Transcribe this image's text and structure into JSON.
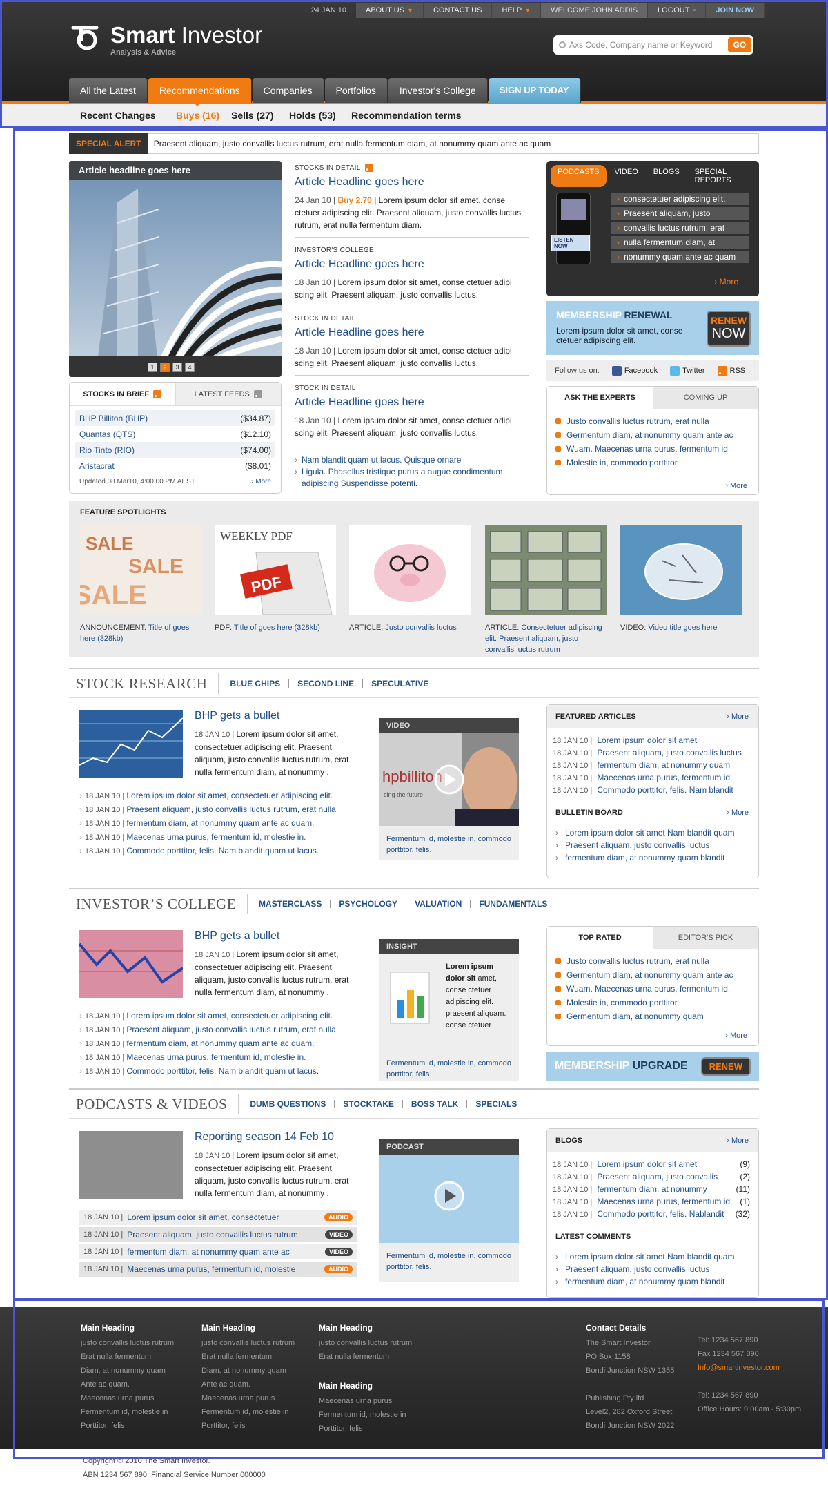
{
  "topbar": {
    "date": "24 JAN 10",
    "items": [
      "ABOUT US",
      "CONTACT US",
      "HELP",
      "WELCOME JOHN ADDIS",
      "LOGOUT",
      "JOIN NOW"
    ]
  },
  "brand": {
    "name_bold": "Smart",
    "name_light": " Investor",
    "tagline": "Analysis & Advice"
  },
  "search": {
    "placeholder": "Axs Code, Company name or Keyword",
    "go": "GO"
  },
  "nav": [
    "All the Latest",
    "Recommendations",
    "Companies",
    "Portfolios",
    "Investor's College",
    "SIGN UP TODAY"
  ],
  "subnav": [
    "Recent Changes",
    "Buys (16)",
    "Sells (27)",
    "Holds (53)",
    "Recommendation terms"
  ],
  "alert": {
    "label": "SPECIAL ALERT",
    "text": "Praesent aliquam,  justo convallis luctus rutrum, erat nulla fermentum diam, at nonummy quam  ante ac quam"
  },
  "hero": {
    "caption": "Article headline goes here",
    "dots": [
      "1",
      "2",
      "3",
      "4"
    ]
  },
  "brief": {
    "tab1": "STOCKS IN BRIEF",
    "tab2": "LATEST FEEDS",
    "rows": [
      [
        "BHP Billiton (BHP)",
        "($34.87)"
      ],
      [
        "Quantas (QTS)",
        "($12.10)"
      ],
      [
        "Rio Tinto (RIO)",
        "($74.00)"
      ],
      [
        "Aristacrat",
        "($8.01)"
      ]
    ],
    "updated": "Updated 08 Mar10, 4:00:00 PM AEST",
    "more": "› More"
  },
  "articles": [
    {
      "kicker": "STOCKS IN DETAIL",
      "headline": "Article Headline goes here",
      "date": "24 Jan 10 | ",
      "buy": "Buy 2.70",
      "sep": " | ",
      "body": "Lorem ipsum dolor sit amet, conse ctetuer adipiscing elit. Praesent aliquam,  justo convallis luctus rutrum, erat nulla fermentum diam."
    },
    {
      "kicker": "INVESTOR'S COLLEGE",
      "headline": "Article Headline goes here",
      "date": "18 Jan 10 | ",
      "body": "Lorem ipsum dolor sit amet, conse ctetuer adipi scing elit. Praesent aliquam,  justo convallis luctus."
    },
    {
      "kicker": "STOCK IN DETAIL",
      "headline": "Article Headline goes here",
      "date": "18 Jan 10 | ",
      "body": "Lorem ipsum dolor sit amet, conse ctetuer adipi scing elit. Praesent aliquam,  justo convallis luctus."
    },
    {
      "kicker": "STOCK IN DETAIL",
      "headline": "Article Headline goes here",
      "date": "18 Jan 10 | ",
      "body": "Lorem ipsum dolor sit amet, conse ctetuer adipi scing elit. Praesent aliquam,  justo convallis luctus."
    }
  ],
  "article_links": [
    "Nam blandit quam ut lacus. Quisque ornare",
    "Ligula. Phasellus tristique purus a augue condimentum adipiscing Suspendisse potenti."
  ],
  "podcasts": {
    "tabs": [
      "PODCASTS",
      "VIDEO",
      "BLOGS",
      "SPECIAL REPORTS"
    ],
    "listen": "LISTEN NOW",
    "items": [
      "consectetuer adipiscing elit.",
      "Praesent aliquam,  justo",
      "convallis luctus rutrum, erat",
      "nulla fermentum diam, at",
      "nonummy quam  ante ac quam"
    ],
    "more": "› More"
  },
  "membership": {
    "t1": "MEMBERSHIP",
    "t2": " RENEWAL",
    "desc": "Lorem ipsum dolor sit amet, conse ctetuer adipiscing elit.",
    "renew": "RENEW",
    "now": "NOW"
  },
  "follow": {
    "label": "Follow us on:",
    "items": [
      "Facebook",
      "Twitter",
      "RSS"
    ]
  },
  "ask": {
    "tab1": "ASK THE EXPERTS",
    "tab2": "COMING UP",
    "items": [
      "Justo convallis luctus rutrum, erat nulla",
      "Germentum diam, at nonummy quam  ante ac",
      "Wuam. Maecenas urna purus, fermentum id,",
      "Molestie in, commodo  porttitor"
    ],
    "more": "› More"
  },
  "features": {
    "heading": "FEATURE SPOTLIGHTS",
    "items": [
      {
        "prefix": "ANNOUNCEMENT: ",
        "link": "Title of goes here (328kb)"
      },
      {
        "prefix": "PDF: ",
        "link": "Title of goes here (328kb)"
      },
      {
        "prefix": "ARTICLE: ",
        "link": "Justo convallis luctus"
      },
      {
        "prefix": "ARTICLE: ",
        "link": "Consectetuer adipiscing elit. Praesent aliquam,  justo convallis luctus rutrum"
      },
      {
        "prefix": "VIDEO: ",
        "link": "Video title goes here"
      }
    ],
    "pdf_label": "WEEKLY PDF",
    "pdf_badge": "PDF",
    "sale": "SALE"
  },
  "research": {
    "title": "STOCK RESEARCH",
    "links": [
      "BLUE CHIPS",
      "SECOND LINE",
      "SPECULATIVE"
    ],
    "headline": "BHP gets a bullet",
    "date": "18 JAN 10 | ",
    "body": "Lorem ipsum dolor sit amet, consectetuer adipiscing elit. Praesent aliquam,  justo convallis luctus rutrum, erat nulla fermentum diam, at nonummy .",
    "list": [
      [
        "18 JAN 10 | ",
        "Lorem ipsum dolor sit amet, consectetuer adipiscing elit."
      ],
      [
        "18 JAN 10 | ",
        "Praesent aliquam,  justo convallis luctus rutrum, erat nulla"
      ],
      [
        "18 JAN 10 | ",
        "fermentum diam, at nonummy quam  ante ac quam."
      ],
      [
        "18 JAN 10 | ",
        "Maecenas urna purus, fermentum id, molestie in."
      ],
      [
        "18 JAN 10 | ",
        "Commodo  porttitor, felis. Nam blandit quam ut lacus."
      ]
    ],
    "video": {
      "label": "VIDEO",
      "caption": "Fermentum id, molestie in, commodo porttitor, felis.",
      "screen_text": "hpbilliton",
      "screen_sub": "cing the future"
    },
    "featured": {
      "title": "FEATURED ARTICLES",
      "more": "› More",
      "items": [
        [
          "18 JAN 10 | ",
          "Lorem ipsum dolor sit amet"
        ],
        [
          "18 JAN 10 | ",
          "Praesent aliquam,  justo convallis luctus"
        ],
        [
          "18 JAN 10 | ",
          "fermentum diam, at nonummy quam"
        ],
        [
          "18 JAN 10 | ",
          "Maecenas urna purus, fermentum id"
        ],
        [
          "18 JAN 10 | ",
          "Commodo  porttitor, felis. Nam blandit"
        ]
      ]
    },
    "bulletin": {
      "title": "BULLETIN BOARD",
      "more": "› More",
      "items": [
        "Lorem ipsum dolor sit amet Nam blandit quam",
        "Praesent aliquam,  justo convallis luctus",
        "fermentum diam, at nonummy quam  blandit"
      ]
    }
  },
  "college": {
    "title": "INVESTOR’S COLLEGE",
    "links": [
      "MASTERCLASS",
      "PSYCHOLOGY",
      "VALUATION",
      "FUNDAMENTALS"
    ],
    "headline": "BHP gets a bullet",
    "date": "18 JAN 10 | ",
    "body": "Lorem ipsum dolor sit amet, consectetuer adipiscing elit. Praesent aliquam,  justo convallis luctus rutrum, erat nulla fermentum diam, at nonummy .",
    "list": [
      [
        "18 JAN 10 | ",
        "Lorem ipsum dolor sit amet, consectetuer adipiscing elit."
      ],
      [
        "18 JAN 10 | ",
        "Praesent aliquam,  justo convallis luctus rutrum, erat nulla"
      ],
      [
        "18 JAN 10 | ",
        "fermentum diam, at nonummy quam  ante ac quam."
      ],
      [
        "18 JAN 10 | ",
        "Maecenas urna purus, fermentum id, molestie in."
      ],
      [
        "18 JAN 10 | ",
        "Commodo  porttitor, felis. Nam blandit quam ut lacus."
      ]
    ],
    "insight": {
      "label": "INSIGHT",
      "bold": "Lorem ipsum dolor sit",
      "text": " amet, conse ctetuer adipiscing elit. praesent aliquam. conse ctetuer",
      "caption": "Fermentum id, molestie in, commodo porttitor, felis."
    },
    "toprated": {
      "tab1": "TOP RATED",
      "tab2": "EDITOR'S PICK",
      "items": [
        "Justo convallis luctus rutrum, erat nulla",
        "Germentum diam, at nonummy quam  ante ac",
        "Wuam. Maecenas urna purus, fermentum id,",
        "Molestie in, commodo  porttitor",
        "Germentum diam, at nonummy quam"
      ],
      "more": "› More"
    },
    "upgrade": {
      "t1": "MEMBERSHIP",
      "t2": " UPGRADE",
      "btn": "RENEW"
    }
  },
  "podvid": {
    "title": "PODCASTS & VIDEOS",
    "links": [
      "DUMB QUESTIONS",
      "STOCKTAKE",
      "BOSS TALK",
      "SPECIALS"
    ],
    "headline": "Reporting season 14 Feb 10",
    "date": "18 JAN 10 | ",
    "body": "Lorem ipsum dolor sit amet, consectetuer adipiscing elit. Praesent aliquam,  justo convallis luctus rutrum, erat nulla fermentum diam, at nonummy .",
    "list": [
      [
        "18 JAN 10 | ",
        "Lorem ipsum dolor sit amet, consectetuer",
        "AUDIO"
      ],
      [
        "18 JAN 10 | ",
        "Praesent aliquam,  justo convallis luctus rutrum",
        "VIDEO"
      ],
      [
        "18 JAN 10 | ",
        "fermentum diam, at nonummy quam  ante ac",
        "VIDEO"
      ],
      [
        "18 JAN 10 | ",
        "Maecenas urna purus, fermentum id, molestie",
        "AUDIO"
      ]
    ],
    "podcast": {
      "label": "PODCAST",
      "caption": "Fermentum id, molestie in, commodo porttitor, felis."
    },
    "blogs": {
      "title": "BLOGS",
      "more": "› More",
      "items": [
        [
          "18 JAN 10 | ",
          "Lorem ipsum dolor sit amet",
          "(9)"
        ],
        [
          "18 JAN 10 | ",
          "Praesent aliquam,  justo convallis",
          "(2)"
        ],
        [
          "18 JAN 10 | ",
          "fermentum diam, at nonummy",
          "(11)"
        ],
        [
          "18 JAN 10 | ",
          "Maecenas urna purus, fermentum id",
          "(1)"
        ],
        [
          "18 JAN 10 | ",
          "Commodo  porttitor, felis. Nablandit",
          "(32)"
        ]
      ]
    },
    "comments": {
      "title": "LATEST COMMENTS",
      "items": [
        "Lorem ipsum dolor sit amet Nam blandit quam",
        "Praesent aliquam,  justo convallis luctus",
        "fermentum diam, at nonummy quam  blandit"
      ]
    }
  },
  "footer": {
    "cols": [
      {
        "heading": "Main Heading",
        "lines": [
          "justo convallis luctus rutrum",
          "Erat nulla fermentum",
          "Diam, at nonummy quam",
          "Ante ac quam.",
          "Maecenas urna purus",
          "Fermentum id, molestie in",
          "Porttitor, felis"
        ]
      },
      {
        "heading": "Main Heading",
        "lines": [
          "justo convallis luctus rutrum",
          "Erat nulla fermentum",
          "Diam, at nonummy quam",
          "Ante ac quam.",
          "Maecenas urna purus",
          "Fermentum id, molestie in",
          "Porttitor, felis"
        ]
      },
      {
        "heading": "Main Heading",
        "lines": [
          "justo convallis luctus rutrum",
          "Erat nulla fermentum"
        ]
      },
      {
        "heading": "Main Heading",
        "lines": [
          "Maecenas urna purus",
          "Fermentum id, molestie in",
          "Porttitor, felis"
        ]
      }
    ],
    "contact": {
      "heading": "Contact Details",
      "a": [
        "The Smart Investor",
        "PO Box 1158",
        "Bondi Junction NSW 1355",
        "",
        "Publishing Pty ltd",
        "Level2, 282 Oxford Street",
        "Bondi Junction NSW 2022"
      ],
      "b": [
        "Tel: 1234 567 890",
        "Fax 1234 567 890",
        "Info@smartinvestor.com",
        "",
        "Tel: 1234 567 890",
        "Office Hours: 9:00am - 5:30pm"
      ]
    },
    "copyright": "Copyright © 2010 The Smart Investor.",
    "abn": "ABN 1234 567 890 .Financial Service Number 000000"
  },
  "colors": {
    "accent": "#f07b12",
    "link": "#1f4f86",
    "light_blue": "#a9d0ea",
    "dark": "#2f2f2f"
  }
}
